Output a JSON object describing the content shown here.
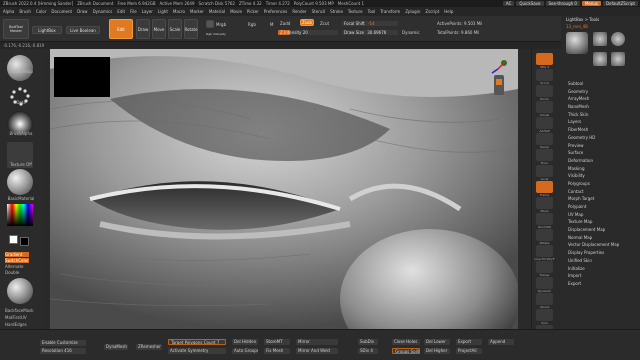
{
  "titlebar": {
    "items": [
      "ZBrush 2022.0.4 [Hmming Sander]",
      "ZBrush Document",
      "Free Mem 6.942GB",
      "Active Mem 2649",
      "Scratch Disk 5762",
      "ZTime 4.32",
      "Timer 4.272",
      "PolyCount 9.503 MP",
      "MeshCount 1"
    ],
    "ac": "AC",
    "quicksave": "QuickSave",
    "seethrough": "See-through 0",
    "menus": "Menus",
    "script": "DefaultZScript"
  },
  "menubar": [
    "Alpha",
    "Brush",
    "Color",
    "Document",
    "Draw",
    "Dynamics",
    "Edit",
    "File",
    "Layer",
    "Light",
    "Macro",
    "Marker",
    "Material",
    "Movie",
    "Picker",
    "Preferences",
    "Render",
    "Stencil",
    "Stroke",
    "Texture",
    "Tool",
    "Transform",
    "Zplugin",
    "Zscript",
    "Help"
  ],
  "toolbar": {
    "boltmaster": "BoltTool Master",
    "lightbox": "LightBox",
    "livebool": "Live Boolean",
    "edit": "Edit",
    "draw": "Draw",
    "move": "Move",
    "scale": "Scale",
    "rotate": "Rotate",
    "mrgb": "Mrgb",
    "rgb": "Rgb",
    "m": "M",
    "rgb_intensity": "Rgb Intensity",
    "zadd": "Zadd",
    "zsub": "Zsub",
    "zcut": "Zcut",
    "z_intensity": "Z Intensity",
    "z_intensity_value": "20",
    "focal_shift": "Focal Shift",
    "focal_shift_value": "-14",
    "draw_size": "Draw Size",
    "draw_size_value": "30.69676",
    "dynamic": "Dynamic",
    "active_points": "ActivePoints: 9.503 Mil",
    "total_points": "TotalPoints: 9.860 Mil"
  },
  "status": "-0.176,-0.216,-0.819",
  "leftpanel": {
    "brush_label": "ClayBuildup",
    "stroke_label": "Dots",
    "alpha_label": "BrushAlpha",
    "texture_label": "Texture Off",
    "material_label": "BasicMaterial",
    "gradient": "Gradient",
    "switch_color": "SwitchColor",
    "alternate": "Alternate",
    "double": "Double",
    "backface": "BackfaceMask",
    "matfirst": "MatFirstUV",
    "hard_edges": "HardEdges",
    "soft_edges": "SoftEdges"
  },
  "shelf": {
    "labels": [
      "SPix 3",
      "Scroll",
      "Zoom",
      "Actual",
      "AAHalf",
      "Persp",
      "Floor",
      "Local",
      "Frame",
      "Move",
      "ZoomSD",
      "Rotate",
      "Line Fill PolyF",
      "Transp",
      "Dynamic",
      "Ghost",
      "Solo",
      "Xpose"
    ]
  },
  "tray": {
    "header": "LightBox > Tools",
    "tool_name": "13_mnl_48",
    "thumbs": [
      "13_mnl_48",
      "Cylinder3D",
      "SimpleBrush",
      "PolyMesh3D"
    ],
    "sections": [
      "Subtool",
      "Geometry",
      "ArrayMesh",
      "NanoMesh",
      "Thick Skin",
      "Layers",
      "FiberMesh",
      "Geometry HD",
      "Preview",
      "Surface",
      "Deformation",
      "Masking",
      "Visibility",
      "Polygroups",
      "Contact",
      "Morph Target",
      "Polypaint",
      "UV Map",
      "Texture Map",
      "Displacement Map",
      "Normal Map",
      "Vector Displacement Map",
      "Display Properties",
      "Unified Skin",
      "Initialize",
      "Import",
      "Export"
    ]
  },
  "bottombar": {
    "enable_customize": "Enable Customize",
    "resolution": "Resolution 416",
    "dynamesh": "DynaMesh",
    "zremesher": "ZRemesher",
    "target_poly": "Target Polygons Count 7",
    "activate_sym": "Activate Symmetry",
    "del_hidden": "Del Hidden",
    "auto_groups": "Auto Groups",
    "storemt": "StoreMT",
    "fix_mesh": "Fix Mesh",
    "mirror": "Mirror",
    "mirror_weld": "Mirror And Weld",
    "subdiv": "SubDiv",
    "sdiv": "SDiv 4",
    "close_holes": "Close Holes",
    "groups_split": "Groups Split",
    "del_lower": "Del Lower",
    "del_higher": "Del Higher",
    "export": "Export",
    "projectall": "ProjectAll",
    "append": "Append"
  },
  "colors": {
    "accent": "#e07a22",
    "panel": "#2b2b2b",
    "dark": "#1c1c1c"
  }
}
